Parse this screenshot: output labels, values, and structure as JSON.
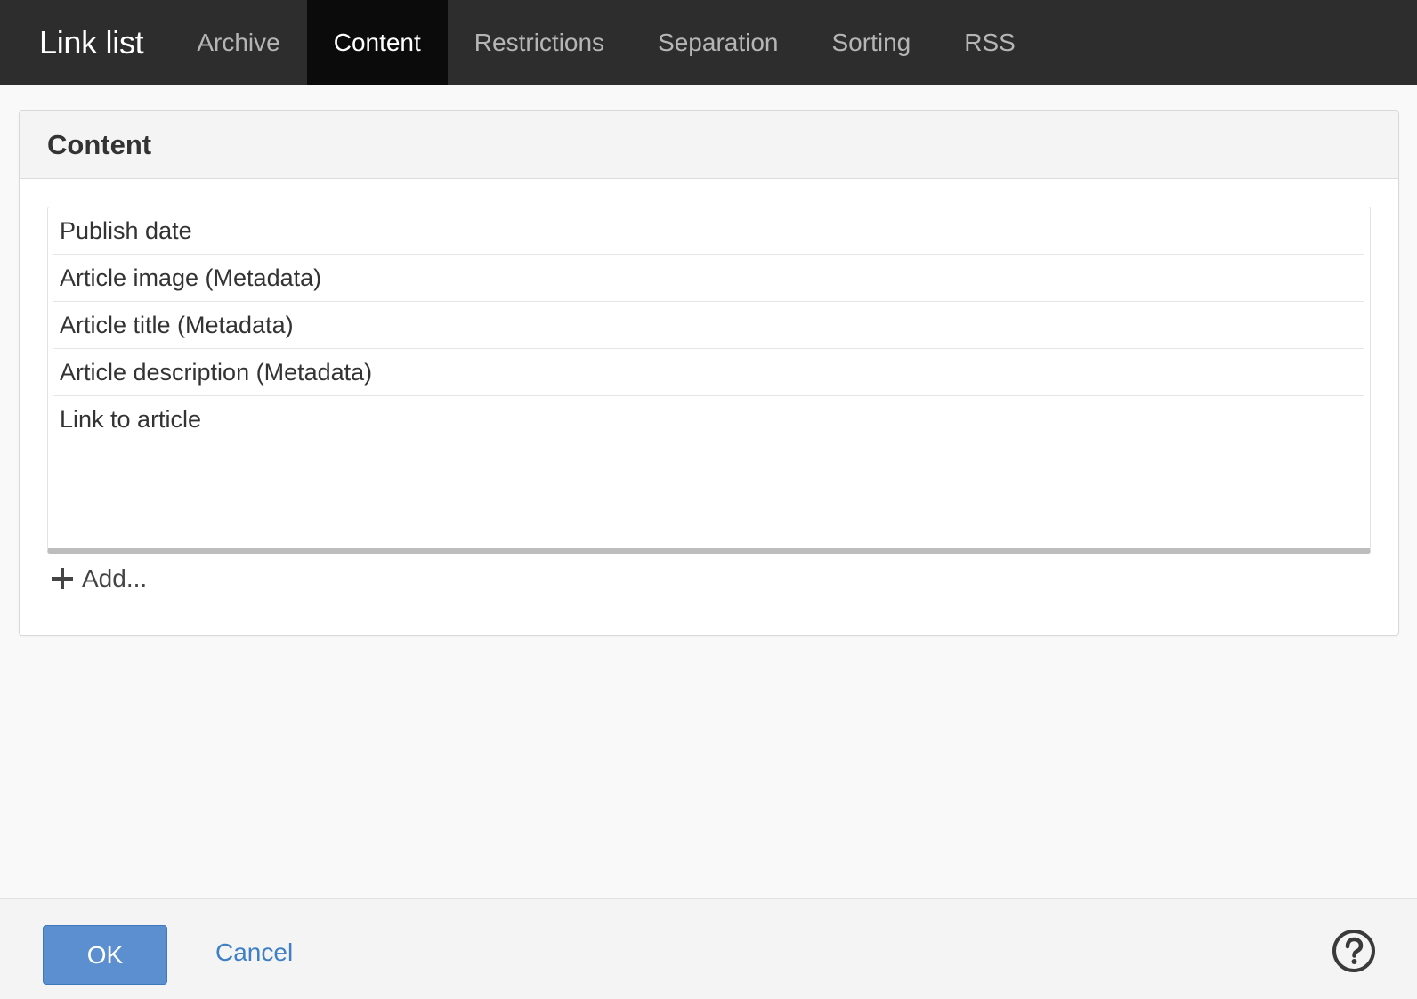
{
  "header": {
    "title": "Link list",
    "tabs": [
      {
        "label": "Archive"
      },
      {
        "label": "Content",
        "active": true
      },
      {
        "label": "Restrictions"
      },
      {
        "label": "Separation"
      },
      {
        "label": "Sorting"
      },
      {
        "label": "RSS"
      }
    ]
  },
  "panel": {
    "title": "Content",
    "items": [
      {
        "label": "Publish date"
      },
      {
        "label": "Article image (Metadata)"
      },
      {
        "label": "Article title (Metadata)"
      },
      {
        "label": "Article description (Metadata)"
      },
      {
        "label": "Link to article"
      }
    ],
    "add_label": "Add..."
  },
  "footer": {
    "ok_label": "OK",
    "cancel_label": "Cancel",
    "help_icon": "help-circle-icon"
  },
  "colors": {
    "topbar": "#2d2d2d",
    "active_tab": "#0b0b0b",
    "primary_button": "#5b8fd0",
    "link": "#3f7fc4"
  }
}
